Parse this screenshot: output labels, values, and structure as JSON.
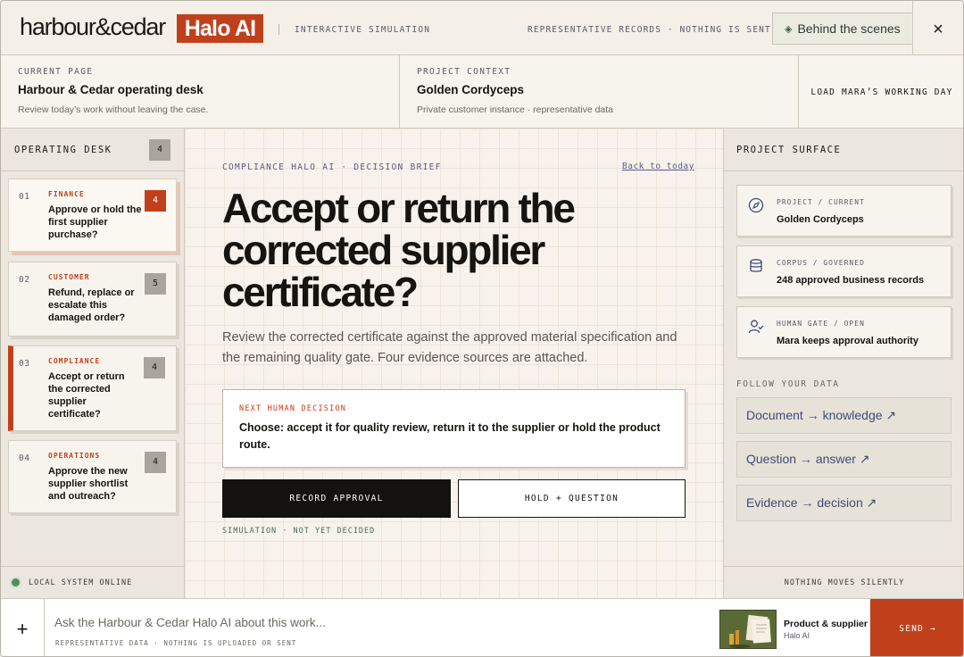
{
  "topbar": {
    "logo_word": "harbour&cedar",
    "logo_badge": "Halo AI",
    "mode": "INTERACTIVE SIMULATION",
    "notice": "REPRESENTATIVE RECORDS · NOTHING IS SENT",
    "behind_label": "Behind the scenes",
    "close_label": "×"
  },
  "context": {
    "page_label": "CURRENT PAGE",
    "page_title": "Harbour & Cedar operating desk",
    "page_sub": "Review today’s work without leaving the case.",
    "project_label": "PROJECT CONTEXT",
    "project_title": "Golden Cordyceps",
    "project_sub": "Private customer instance · representative data",
    "load_label": "LOAD MARA’S WORKING DAY"
  },
  "desk": {
    "title": "OPERATING DESK",
    "count": "4",
    "items": [
      {
        "num": "01",
        "category": "FINANCE",
        "text": "Approve or hold the first supplier purchase?",
        "badge": "4"
      },
      {
        "num": "02",
        "category": "CUSTOMER",
        "text": "Refund, replace or escalate this damaged order?",
        "badge": "5"
      },
      {
        "num": "03",
        "category": "COMPLIANCE",
        "text": "Accept or return the corrected supplier certificate?",
        "badge": "4"
      },
      {
        "num": "04",
        "category": "OPERATIONS",
        "text": "Approve the new supplier shortlist and outreach?",
        "badge": "4"
      }
    ],
    "footer": "LOCAL SYSTEM ONLINE"
  },
  "brief": {
    "label": "COMPLIANCE HALO AI · DECISION BRIEF",
    "back": "Back to today",
    "headline": "Accept or return the corrected supplier certificate?",
    "lede": "Review the corrected certificate against the approved material specification and the remaining quality gate. Four evidence sources are attached.",
    "decision_label": "NEXT HUMAN DECISION",
    "decision_text": "Choose: accept it for quality review, return it to the supplier or hold the product route.",
    "approve": "RECORD APPROVAL",
    "hold": "HOLD + QUESTION",
    "status": "SIMULATION · NOT YET DECIDED"
  },
  "surface": {
    "title": "PROJECT SURFACE",
    "cards": [
      {
        "label": "PROJECT / CURRENT",
        "value": "Golden Cordyceps",
        "icon": "compass-icon"
      },
      {
        "label": "CORPUS / GOVERNED",
        "value": "248 approved business records",
        "icon": "database-icon"
      },
      {
        "label": "HUMAN GATE / OPEN",
        "value": "Mara keeps approval authority",
        "icon": "user-check-icon"
      }
    ],
    "follow_label": "FOLLOW YOUR DATA",
    "links": [
      "Document → knowledge ↗",
      "Question → answer ↗",
      "Evidence → decision ↗"
    ],
    "footer": "NOTHING MOVES SILENTLY"
  },
  "bottom": {
    "plus": "+",
    "placeholder": "Ask the Harbour & Cedar Halo AI about this work...",
    "note": "REPRESENTATIVE DATA · NOTHING IS UPLOADED OR SENT",
    "chip_title": "Product & supplier",
    "chip_sub": "Halo AI",
    "send": "SEND →"
  },
  "colors": {
    "accent": "#c0401c",
    "ink": "#161410",
    "paper": "#f3efe7",
    "link": "#3f4a7a"
  }
}
